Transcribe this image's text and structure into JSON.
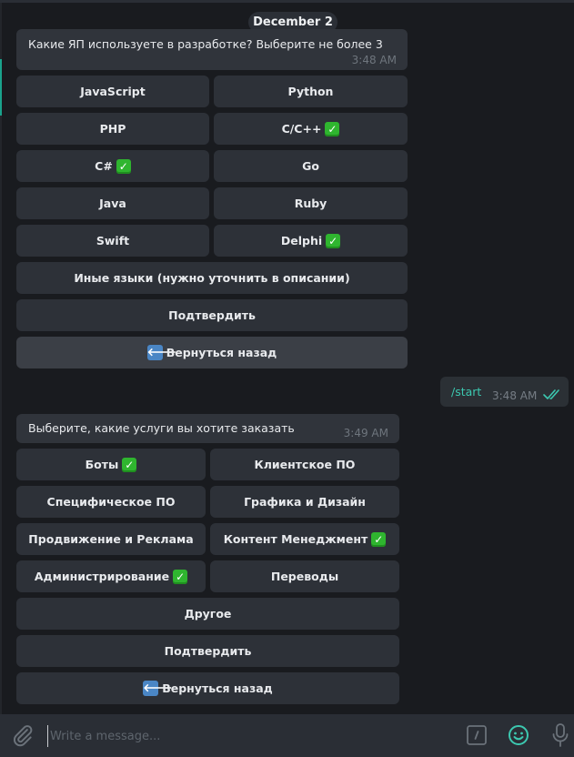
{
  "chat": {
    "date_separator": "December 2",
    "messages": [
      {
        "type": "incoming",
        "text": "Какие ЯП используете в разработке? Выберите не более 3",
        "time": "3:48 AM",
        "keyboard": {
          "rows": [
            [
              {
                "label": "JavaScript",
                "checked": false
              },
              {
                "label": "Python",
                "checked": false
              }
            ],
            [
              {
                "label": "PHP",
                "checked": false
              },
              {
                "label": "C/C++",
                "checked": true
              }
            ],
            [
              {
                "label": "C#",
                "checked": true
              },
              {
                "label": "Go",
                "checked": false
              }
            ],
            [
              {
                "label": "Java",
                "checked": false
              },
              {
                "label": "Ruby",
                "checked": false
              }
            ],
            [
              {
                "label": "Swift",
                "checked": false
              },
              {
                "label": "Delphi",
                "checked": true
              }
            ],
            [
              {
                "label": "Иные языки (нужно уточнить в описании)",
                "checked": false
              }
            ],
            [
              {
                "label": "Подтвердить",
                "checked": false
              }
            ],
            [
              {
                "label": "Вернуться назад",
                "icon": "back-arrow-icon",
                "checked": false
              }
            ]
          ]
        }
      },
      {
        "type": "outgoing",
        "text": "/start",
        "time": "3:48 AM",
        "status": "read"
      },
      {
        "type": "incoming",
        "text": "Выберите, какие услуги вы хотите заказать",
        "time": "3:49 AM",
        "keyboard": {
          "rows": [
            [
              {
                "label": "Боты",
                "checked": true
              },
              {
                "label": "Клиентское ПО",
                "checked": false
              }
            ],
            [
              {
                "label": "Специфическое ПО",
                "checked": false
              },
              {
                "label": "Графика и Дизайн",
                "checked": false
              }
            ],
            [
              {
                "label": "Продвижение и Реклама",
                "checked": false
              },
              {
                "label": "Контент Менеджмент",
                "checked": true
              }
            ],
            [
              {
                "label": "Администрирование",
                "checked": true
              },
              {
                "label": "Переводы",
                "checked": false
              }
            ],
            [
              {
                "label": "Другое",
                "checked": false
              }
            ],
            [
              {
                "label": "Подтвердить",
                "checked": false
              }
            ],
            [
              {
                "label": "Вернуться назад",
                "icon": "back-arrow-icon",
                "checked": false
              }
            ]
          ]
        }
      }
    ]
  },
  "composer": {
    "placeholder": "Write a message...",
    "value": ""
  },
  "colors": {
    "accent": "#3cc8b0",
    "background": "#191b1f",
    "bubble": "#30343b",
    "button": "#2d3138",
    "check": "#2fb52f"
  }
}
